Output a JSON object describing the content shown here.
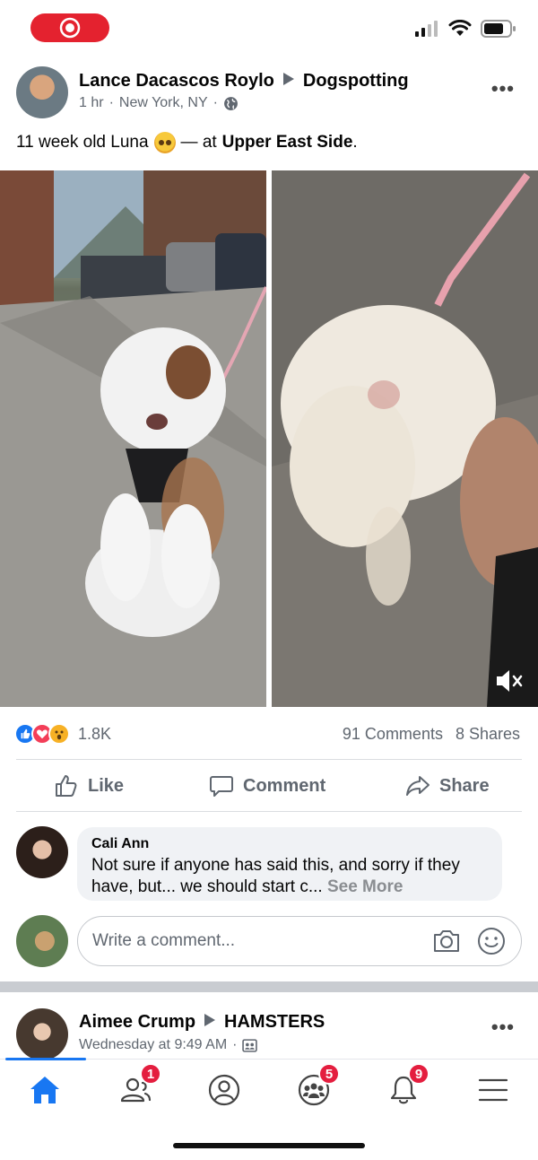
{
  "colors": {
    "brand": "#1877f2",
    "recording": "#e4222f",
    "badge": "#e41e3f"
  },
  "post": {
    "author": "Lance Dacascos Roylo",
    "group": "Dogspotting",
    "time": "1 hr",
    "location": "New York, NY",
    "caption_prefix": "11 week old Luna",
    "caption_emoji": "pleading-face-icon",
    "caption_mid": "— at",
    "caption_place": "Upper East Side",
    "caption_end": ".",
    "reactions": [
      "like-icon",
      "love-icon",
      "wow-icon"
    ],
    "reaction_count": "1.8K",
    "comments_count": "91 Comments",
    "shares_count": "8 Shares"
  },
  "actions": {
    "like": "Like",
    "comment": "Comment",
    "share": "Share"
  },
  "comment": {
    "author": "Cali Ann",
    "text": "Not sure if anyone has said this, and sorry if they have, but... we should start c...",
    "see_more": "See More"
  },
  "composer": {
    "placeholder": "Write a comment..."
  },
  "next_post": {
    "author": "Aimee Crump",
    "group": "HAMSTERS",
    "time": "Wednesday at 9:49 AM"
  },
  "tabs": [
    {
      "name": "home",
      "badge": ""
    },
    {
      "name": "friends",
      "badge": "1"
    },
    {
      "name": "profile",
      "badge": ""
    },
    {
      "name": "groups",
      "badge": "5"
    },
    {
      "name": "notifications",
      "badge": "9"
    },
    {
      "name": "menu",
      "badge": ""
    }
  ]
}
